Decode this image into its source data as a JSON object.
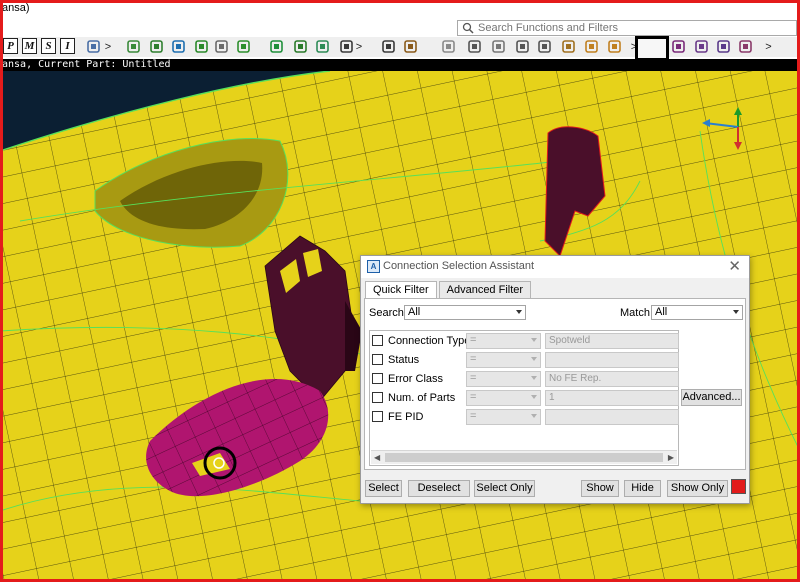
{
  "window": {
    "title_fragment": "ansa)"
  },
  "search": {
    "placeholder": "Search Functions and Filters"
  },
  "toolbar": {
    "letter_buttons": [
      "P",
      "M",
      "S",
      "I"
    ],
    "chevron": ">",
    "icons": [
      "render-mode-icon",
      "entity-manager-icon",
      "properties-icon",
      "materials-icon",
      "clipboard-icon",
      "list-icon",
      "parts-icon",
      "check-icon",
      "pen-icon",
      "transform-icon",
      "zoom-frame-icon",
      "zoom-icon",
      "undo-icon",
      "redo-icon",
      "pointer-icon",
      "grid-icon",
      "delete-icon",
      "mesh-icon",
      "move-icon",
      "hand-icon",
      "move-cross-icon",
      "connection-tool-icon",
      "highlight-tool-icon",
      "align-icon",
      "arrows-icon",
      "weld-icon",
      "chevron-icon"
    ]
  },
  "status_line": "ansa,  Current Part: Untitled",
  "dialog": {
    "title": "Connection Selection Assistant",
    "tabs": [
      "Quick Filter",
      "Advanced Filter"
    ],
    "search_label": "Search",
    "search_value": "All",
    "match_label": "Match",
    "match_value": "All",
    "rows": [
      {
        "name": "Connection Type",
        "op": "=",
        "value": "Spotweld"
      },
      {
        "name": "Status",
        "op": "=",
        "value": ""
      },
      {
        "name": "Error Class",
        "op": "=",
        "value": "No FE Rep."
      },
      {
        "name": "Num. of Parts",
        "op": "=",
        "value": "1"
      },
      {
        "name": "FE PID",
        "op": "=",
        "value": ""
      }
    ],
    "advanced_button": "Advanced...",
    "buttons": {
      "select": "Select",
      "deselect": "Deselect",
      "select_only": "Select Only",
      "show": "Show",
      "hide": "Hide",
      "show_only": "Show Only"
    },
    "color_swatch": "#e21b1b"
  },
  "colors": {
    "mesh_yellow": "#e6d21a",
    "mesh_magenta": "#b0156f",
    "mesh_dark": "#4a0f2a",
    "mesh_edges_green": "#57e05a",
    "frame_red": "#e41b1b"
  }
}
